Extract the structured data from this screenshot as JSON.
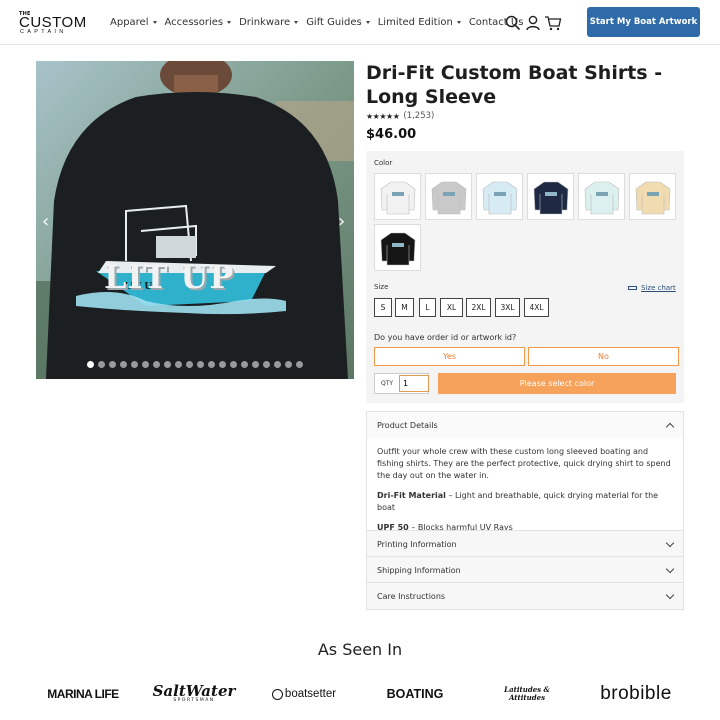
{
  "header": {
    "logo": {
      "line1": "THE",
      "line2": "CUSTOM",
      "line3": "CAPTAIN"
    },
    "nav": [
      {
        "label": "Apparel",
        "dropdown": true
      },
      {
        "label": "Accessories",
        "dropdown": true
      },
      {
        "label": "Drinkware",
        "dropdown": true
      },
      {
        "label": "Gift Guides",
        "dropdown": true
      },
      {
        "label": "Limited Edition",
        "dropdown": true
      },
      {
        "label": "Contact Us",
        "dropdown": false
      }
    ],
    "icons": [
      "search-icon",
      "account-icon",
      "cart-icon"
    ],
    "cta_label": "Start My Boat Artwork"
  },
  "gallery": {
    "image_text": "LIT UP",
    "dot_count": 20,
    "active_dot": 0
  },
  "product": {
    "title": "Dri-Fit Custom Boat Shirts - Long Sleeve",
    "stars": "★★★★★",
    "rating_count": "(1,253)",
    "price": "$46.00",
    "color_label": "Color",
    "colors": [
      {
        "name": "white",
        "hex": "#f2f2f2"
      },
      {
        "name": "gray",
        "hex": "#c9c9c9"
      },
      {
        "name": "light blue",
        "hex": "#d6ebf3"
      },
      {
        "name": "navy",
        "hex": "#1e2a44"
      },
      {
        "name": "mint",
        "hex": "#dcf1ef"
      },
      {
        "name": "sand",
        "hex": "#f0dcb0"
      },
      {
        "name": "black",
        "hex": "#151515"
      }
    ],
    "size_label": "Size",
    "size_chart": "Size chart",
    "sizes": [
      "S",
      "M",
      "L",
      "XL",
      "2XL",
      "3XL",
      "4XL"
    ],
    "order_question": "Do you have order id or artwork id?",
    "yes_label": "Yes",
    "no_label": "No",
    "qty_label": "QTY",
    "qty_value": "1",
    "add_button": "Please select color"
  },
  "details": {
    "heading": "Product Details",
    "intro": "Outfit your whole crew with these custom long sleeved boating and fishing shirts. They are the perfect protective, quick drying shirt to spend the day out on the water in.",
    "feature1_bold": "Dri-Fit Material",
    "feature1_text": " – Light and breathable, quick drying material for the boat",
    "feature2_bold": "UPF 50",
    "feature2_text": " – Blocks harmful UV Rays"
  },
  "accordion": [
    {
      "label": "Printing Information"
    },
    {
      "label": "Shipping Information"
    },
    {
      "label": "Care Instructions"
    }
  ],
  "seen_in": {
    "title": "As Seen In",
    "brands": [
      "MARINA LIFE",
      "SaltWater",
      "SPORTSMAN",
      "boatsetter",
      "BOATING",
      "Latitudes & Attitudes",
      "brobible"
    ]
  }
}
